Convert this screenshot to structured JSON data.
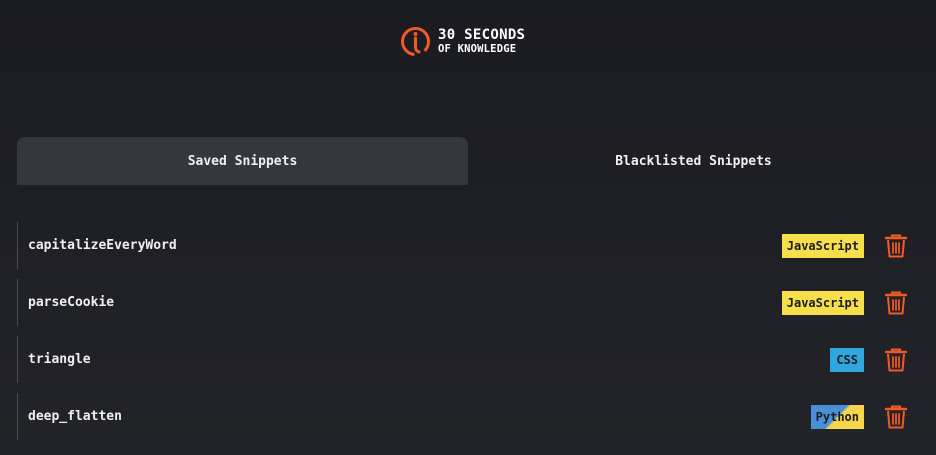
{
  "logo": {
    "line1": "30 SECONDS",
    "line2": "OF KNOWLEDGE",
    "icon": "lightbulb-logo-icon",
    "accent": "#f05a26"
  },
  "tabs": [
    {
      "label": "Saved Snippets",
      "active": true
    },
    {
      "label": "Blacklisted Snippets",
      "active": false
    }
  ],
  "snippets": [
    {
      "name": "capitalizeEveryWord",
      "language": "JavaScript",
      "badge_color": "#f7df4b",
      "action_icon": "trash-icon"
    },
    {
      "name": "parseCookie",
      "language": "JavaScript",
      "badge_color": "#f7df4b",
      "action_icon": "trash-icon"
    },
    {
      "name": "triangle",
      "language": "CSS",
      "badge_color": "#2fa6dc",
      "action_icon": "trash-icon"
    },
    {
      "name": "deep_flatten",
      "language": "Python",
      "badge_color": "#4b8fd6",
      "action_icon": "trash-icon"
    }
  ],
  "colors": {
    "background": "#1b1c22",
    "active_tab": "#35373e",
    "trash": "#f05a26"
  }
}
